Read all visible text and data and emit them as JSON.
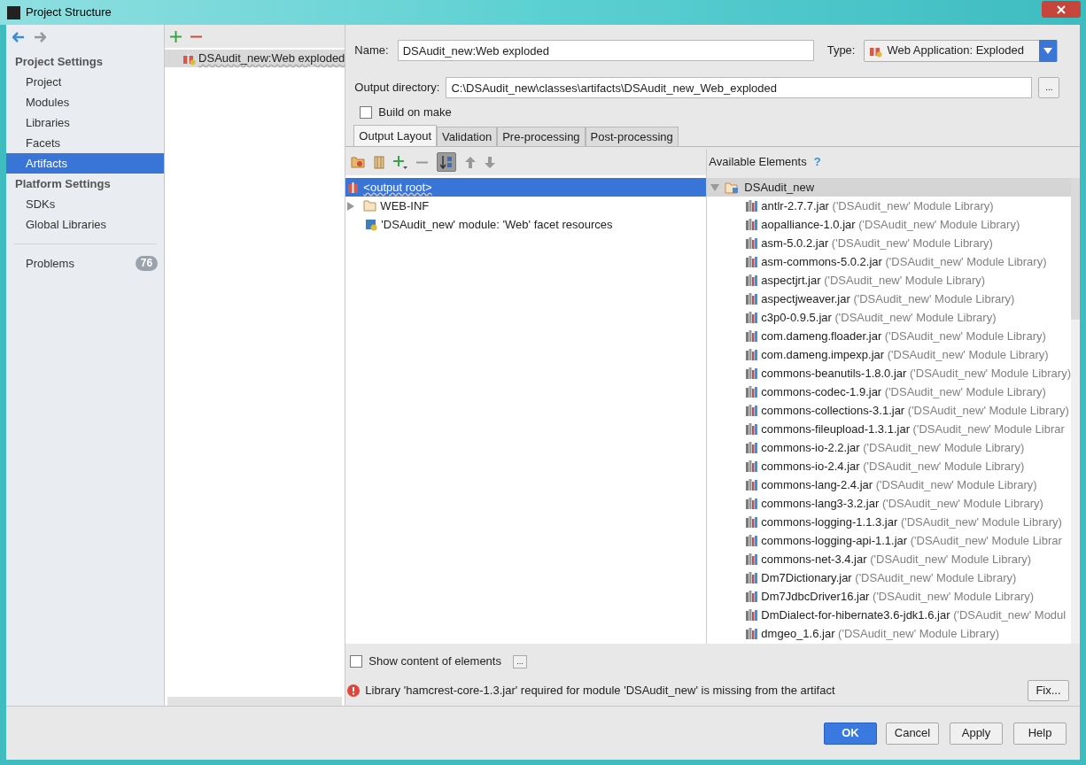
{
  "window": {
    "title": "Project Structure"
  },
  "sidebar": {
    "sections": [
      {
        "title": "Project Settings",
        "items": [
          {
            "label": "Project",
            "selected": false
          },
          {
            "label": "Modules",
            "selected": false
          },
          {
            "label": "Libraries",
            "selected": false
          },
          {
            "label": "Facets",
            "selected": false
          },
          {
            "label": "Artifacts",
            "selected": true
          }
        ]
      },
      {
        "title": "Platform Settings",
        "items": [
          {
            "label": "SDKs",
            "selected": false
          },
          {
            "label": "Global Libraries",
            "selected": false
          }
        ]
      }
    ],
    "problems": {
      "label": "Problems",
      "count": "76"
    }
  },
  "artifacts": [
    {
      "label": "DSAudit_new:Web exploded",
      "selected": true
    }
  ],
  "form": {
    "name_label": "Name:",
    "name": "DSAudit_new:Web exploded",
    "type_label": "Type:",
    "type": "Web Application: Exploded",
    "output_label": "Output directory:",
    "output": "C:\\DSAudit_new\\classes\\artifacts\\DSAudit_new_Web_exploded",
    "build_on_make": {
      "label": "Build on make",
      "checked": false
    }
  },
  "tabs": [
    {
      "label": "Output Layout",
      "selected": true
    },
    {
      "label": "Validation",
      "selected": false
    },
    {
      "label": "Pre-processing",
      "selected": false
    },
    {
      "label": "Post-processing",
      "selected": false
    }
  ],
  "layout_tree": [
    {
      "kind": "root",
      "label": "<output root>",
      "selected": true
    },
    {
      "kind": "folder",
      "label": "WEB-INF",
      "selected": false
    },
    {
      "kind": "facet",
      "label": "'DSAudit_new' module: 'Web' facet resources",
      "selected": false
    }
  ],
  "available": {
    "title": "Available Elements",
    "help": "?",
    "module": {
      "label": "DSAudit_new",
      "expanded": true,
      "children": [
        {
          "name": "antlr-2.7.7.jar",
          "detail": "('DSAudit_new' Module Library)"
        },
        {
          "name": "aopalliance-1.0.jar",
          "detail": "('DSAudit_new' Module Library)"
        },
        {
          "name": "asm-5.0.2.jar",
          "detail": "('DSAudit_new' Module Library)"
        },
        {
          "name": "asm-commons-5.0.2.jar",
          "detail": "('DSAudit_new' Module Library)"
        },
        {
          "name": "aspectjrt.jar",
          "detail": "('DSAudit_new' Module Library)"
        },
        {
          "name": "aspectjweaver.jar",
          "detail": "('DSAudit_new' Module Library)"
        },
        {
          "name": "c3p0-0.9.5.jar",
          "detail": "('DSAudit_new' Module Library)"
        },
        {
          "name": "com.dameng.floader.jar",
          "detail": "('DSAudit_new' Module Library)"
        },
        {
          "name": "com.dameng.impexp.jar",
          "detail": "('DSAudit_new' Module Library)"
        },
        {
          "name": "commons-beanutils-1.8.0.jar",
          "detail": "('DSAudit_new' Module Library)"
        },
        {
          "name": "commons-codec-1.9.jar",
          "detail": "('DSAudit_new' Module Library)"
        },
        {
          "name": "commons-collections-3.1.jar",
          "detail": "('DSAudit_new' Module Library)"
        },
        {
          "name": "commons-fileupload-1.3.1.jar",
          "detail": "('DSAudit_new' Module Librar"
        },
        {
          "name": "commons-io-2.2.jar",
          "detail": "('DSAudit_new' Module Library)"
        },
        {
          "name": "commons-io-2.4.jar",
          "detail": "('DSAudit_new' Module Library)"
        },
        {
          "name": "commons-lang-2.4.jar",
          "detail": "('DSAudit_new' Module Library)"
        },
        {
          "name": "commons-lang3-3.2.jar",
          "detail": "('DSAudit_new' Module Library)"
        },
        {
          "name": "commons-logging-1.1.3.jar",
          "detail": "('DSAudit_new' Module Library)"
        },
        {
          "name": "commons-logging-api-1.1.jar",
          "detail": "('DSAudit_new' Module Librar"
        },
        {
          "name": "commons-net-3.4.jar",
          "detail": "('DSAudit_new' Module Library)"
        },
        {
          "name": "Dm7Dictionary.jar",
          "detail": "('DSAudit_new' Module Library)"
        },
        {
          "name": "Dm7JdbcDriver16.jar",
          "detail": "('DSAudit_new' Module Library)"
        },
        {
          "name": "DmDialect-for-hibernate3.6-jdk1.6.jar",
          "detail": "('DSAudit_new' Modul"
        },
        {
          "name": "dmgeo_1.6.jar",
          "detail": "('DSAudit_new' Module Library)"
        }
      ]
    }
  },
  "show_content": {
    "label": "Show content of elements",
    "checked": false,
    "more": "..."
  },
  "error": {
    "message": "Library 'hamcrest-core-1.3.jar' required for module 'DSAudit_new' is missing from the artifact",
    "fix": "Fix..."
  },
  "output_more": "...",
  "buttons": [
    {
      "label": "OK",
      "default": true
    },
    {
      "label": "Cancel",
      "default": false
    },
    {
      "label": "Apply",
      "default": false
    },
    {
      "label": "Help",
      "default": false
    }
  ]
}
